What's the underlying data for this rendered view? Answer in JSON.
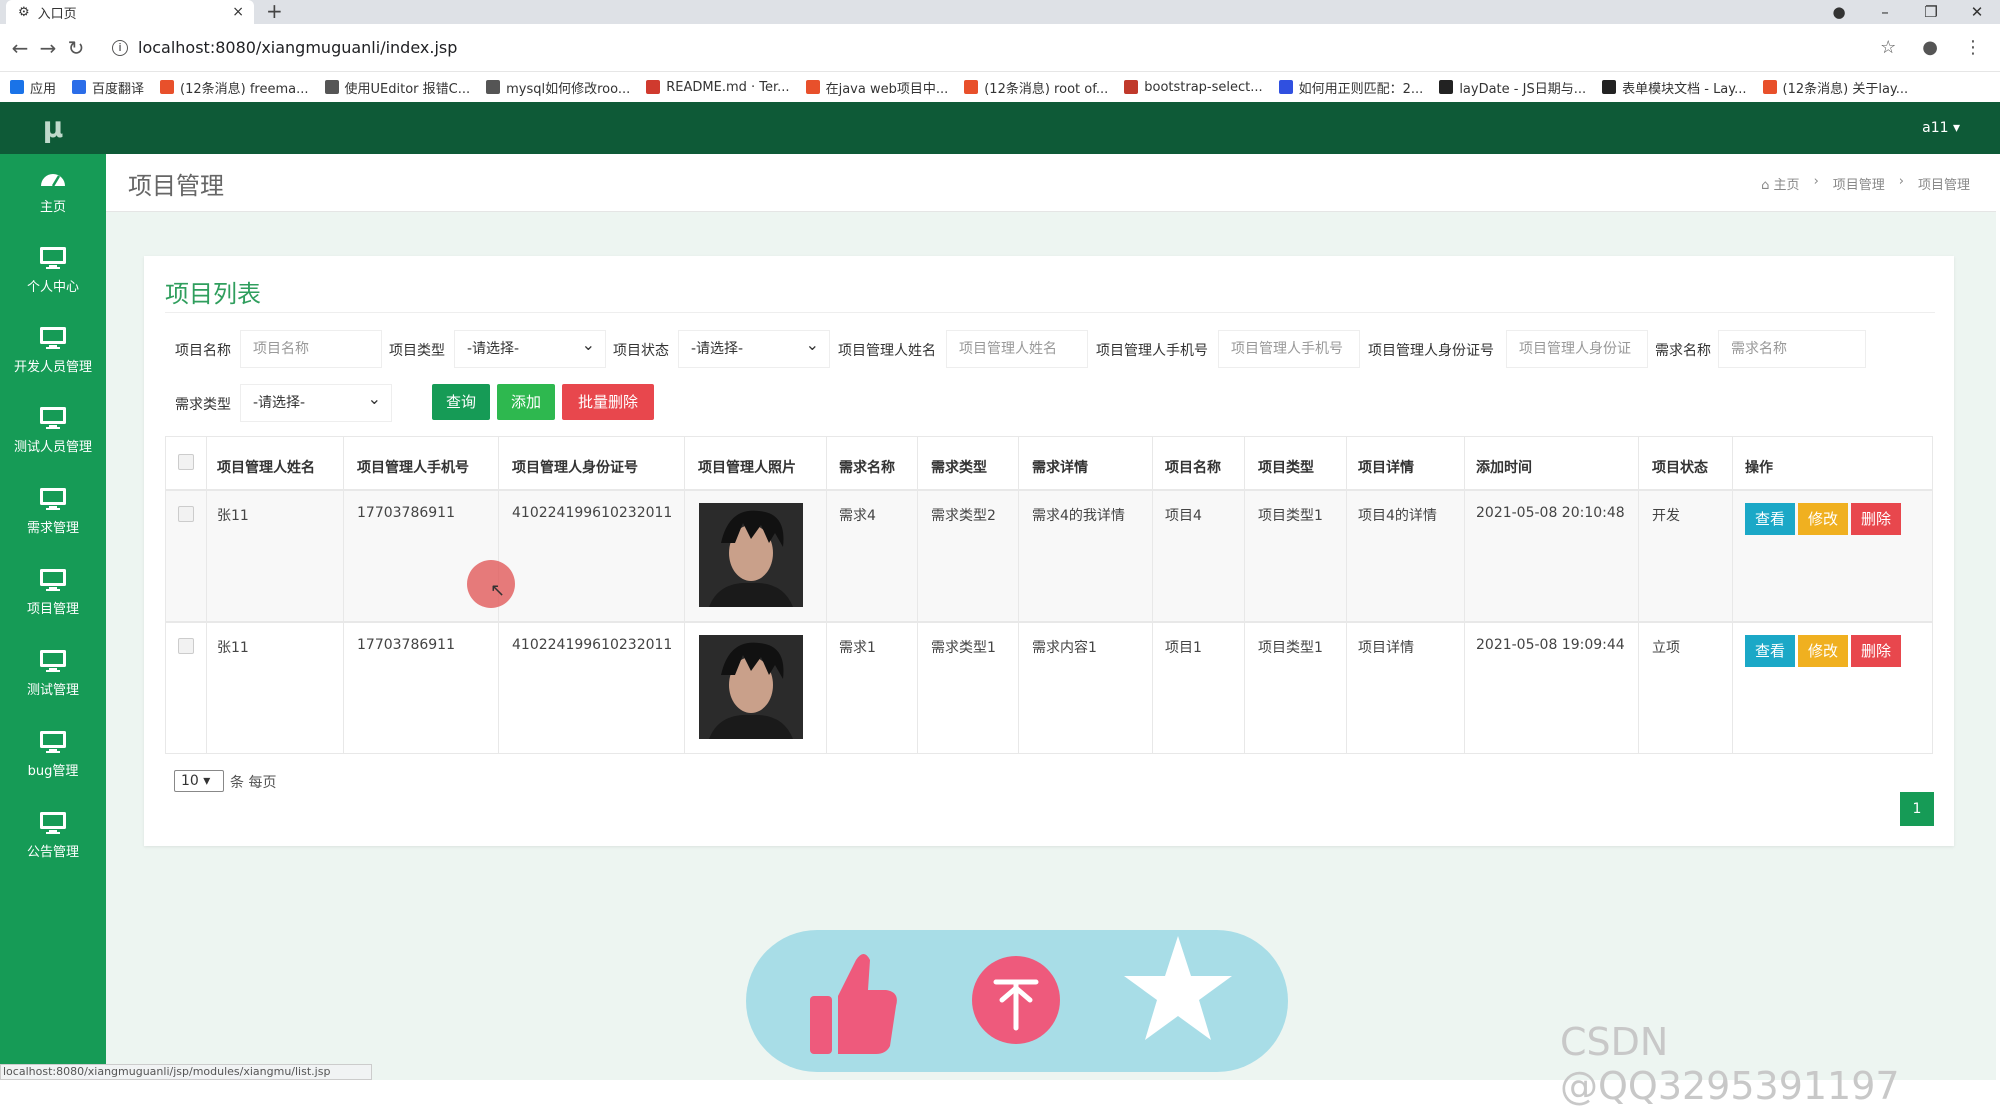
{
  "browser": {
    "tab_title": "入口页",
    "tab_close": "×",
    "new_tab": "+",
    "url": "localhost:8080/xiangmuguanli/index.jsp",
    "win_controls": [
      "–",
      "❐",
      "✕"
    ],
    "bookmarks": [
      {
        "label": "应用",
        "color": "#1a73e8"
      },
      {
        "label": "百度翻译",
        "color": "#2b6de8"
      },
      {
        "label": "(12条消息) freema...",
        "color": "#e8502b"
      },
      {
        "label": "使用UEditor 报错C...",
        "color": "#555555"
      },
      {
        "label": "mysql如何修改roo...",
        "color": "#555555"
      },
      {
        "label": "README.md · Ter...",
        "color": "#d03a2e"
      },
      {
        "label": "在java web项目中...",
        "color": "#e8502b"
      },
      {
        "label": "(12条消息) root of...",
        "color": "#e8502b"
      },
      {
        "label": "bootstrap-select...",
        "color": "#c0392b"
      },
      {
        "label": "如何用正则匹配：2...",
        "color": "#3050e0"
      },
      {
        "label": "layDate - JS日期与...",
        "color": "#222222"
      },
      {
        "label": "表单模块文档 - Lay...",
        "color": "#222222"
      },
      {
        "label": "(12条消息) 关于lay...",
        "color": "#e8502b"
      }
    ],
    "status_url": "localhost:8080/xiangmuguanli/jsp/modules/xiangmu/list.jsp"
  },
  "app": {
    "logo": "μ",
    "user": "a11 ▾",
    "sidebar": [
      {
        "label": "主页",
        "icon": "dashboard-icon"
      },
      {
        "label": "个人中心",
        "icon": "monitor-icon"
      },
      {
        "label": "开发人员管理",
        "icon": "monitor-icon"
      },
      {
        "label": "测试人员管理",
        "icon": "monitor-icon"
      },
      {
        "label": "需求管理",
        "icon": "monitor-icon"
      },
      {
        "label": "项目管理",
        "icon": "monitor-icon"
      },
      {
        "label": "测试管理",
        "icon": "monitor-icon"
      },
      {
        "label": "bug管理",
        "icon": "monitor-icon"
      },
      {
        "label": "公告管理",
        "icon": "monitor-icon"
      }
    ],
    "page_title": "项目管理",
    "breadcrumb": [
      "主页",
      "›",
      "项目管理",
      "›",
      "项目管理"
    ],
    "panel_title": "项目列表",
    "filters": {
      "name_label": "项目名称",
      "name_ph": "项目名称",
      "type_label": "项目类型",
      "type_value": "-请选择-",
      "status_label": "项目状态",
      "status_value": "-请选择-",
      "mgr_name_label": "项目管理人姓名",
      "mgr_name_ph": "项目管理人姓名",
      "mgr_phone_label": "项目管理人手机号",
      "mgr_phone_ph": "项目管理人手机号",
      "mgr_id_label": "项目管理人身份证号",
      "mgr_id_ph": "项目管理人身份证",
      "req_name_label": "需求名称",
      "req_name_ph": "需求名称",
      "req_type_label": "需求类型",
      "req_type_value": "-请选择-"
    },
    "buttons": {
      "search": "查询",
      "add": "添加",
      "batch_delete": "批量删除"
    },
    "columns": [
      "项目管理人姓名",
      "项目管理人手机号",
      "项目管理人身份证号",
      "项目管理人照片",
      "需求名称",
      "需求类型",
      "需求详情",
      "项目名称",
      "项目类型",
      "项目详情",
      "添加时间",
      "项目状态",
      "操作"
    ],
    "rows": [
      {
        "name": "张11",
        "phone": "17703786911",
        "idcard": "410224199610232011",
        "req": "需求4",
        "req_type": "需求类型2",
        "req_detail": "需求4的我详情",
        "proj": "项目4",
        "proj_type": "项目类型1",
        "proj_detail": "项目4的详情",
        "time": "2021-05-08 20:10:48",
        "status": "开发"
      },
      {
        "name": "张11",
        "phone": "17703786911",
        "idcard": "410224199610232011",
        "req": "需求1",
        "req_type": "需求类型1",
        "req_detail": "需求内容1",
        "proj": "项目1",
        "proj_type": "项目类型1",
        "proj_detail": "项目详情",
        "time": "2021-05-08 19:09:44",
        "status": "立项"
      }
    ],
    "row_actions": {
      "view": "查看",
      "edit": "修改",
      "delete": "删除"
    },
    "pager": {
      "page_size": "10",
      "per_page_text": "条 每页",
      "current": "1"
    }
  },
  "overlay": {
    "icons": [
      "thumbs-up-icon",
      "coin-icon",
      "star-icon"
    ]
  },
  "watermark": "CSDN @QQ3295391197",
  "colors": {
    "sidebar": "#169b56",
    "header": "#0e5a37",
    "view": "#1ba8c7",
    "edit": "#f0b020",
    "delete": "#e8474d",
    "search": "#169b56",
    "add": "#2eb84f",
    "batch": "#e8474d"
  }
}
